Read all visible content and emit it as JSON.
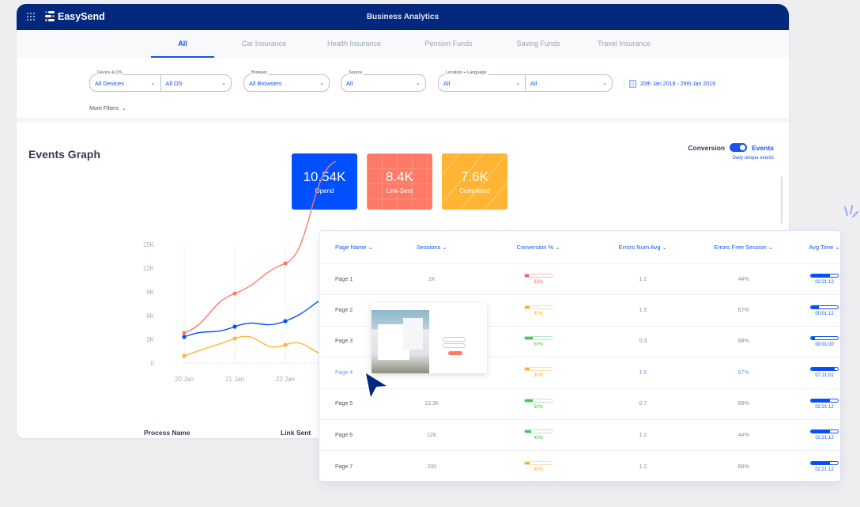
{
  "header": {
    "brand": "EasySend",
    "title": "Business Analytics"
  },
  "tabs": [
    {
      "label": "All",
      "active": true
    },
    {
      "label": "Car Insurance"
    },
    {
      "label": "Health Insurance"
    },
    {
      "label": "Pension Funds"
    },
    {
      "label": "Saving Funds"
    },
    {
      "label": "Travel Insurance"
    }
  ],
  "filters": {
    "device_os": {
      "label": "Device & OS",
      "device": "All Devices",
      "os": "All OS"
    },
    "browser": {
      "label": "Browser",
      "value": "All Browsers"
    },
    "source": {
      "label": "Source",
      "value": "All"
    },
    "location": {
      "label": "Location + Language",
      "location": "All",
      "language": "All"
    },
    "date_range": "20th Jan 2019 - 29th Jan 2019",
    "more_filters": "More Filters"
  },
  "graph": {
    "title": "Events Graph",
    "toggle": {
      "left": "Conversion",
      "right": "Events",
      "state": "Events",
      "caption": "Daily unique events"
    },
    "kpis": [
      {
        "value": "10.54K",
        "label": "Opend",
        "color": "#0050ff"
      },
      {
        "value": "8.4K",
        "label": "Link-Sent",
        "color": "#ff7a66"
      },
      {
        "value": "7.6K",
        "label": "Completed",
        "color": "#ffb433"
      }
    ],
    "bottom_headers": [
      "Process Name",
      "Link Sent"
    ]
  },
  "chart_data": {
    "type": "line",
    "x": [
      "20 Jan",
      "21 Jan",
      "22 Jan"
    ],
    "yticks": [
      "0",
      "3K",
      "6K",
      "9K",
      "12K",
      "15K"
    ],
    "ylim": [
      0,
      15000
    ],
    "grid": "vertical dashed",
    "series": [
      {
        "name": "Link-Sent",
        "color": "#ff7a66",
        "values": [
          3800,
          8800,
          12600
        ]
      },
      {
        "name": "Opend",
        "color": "#0050ff",
        "values": [
          3300,
          4600,
          5300
        ]
      },
      {
        "name": "Completed",
        "color": "#ffb433",
        "values": [
          900,
          3100,
          2300
        ]
      }
    ]
  },
  "table": {
    "columns": [
      "Page Name",
      "Sessions",
      "Conversion %",
      "Errors Num Avg",
      "Errors Free Session",
      "Avg Time"
    ],
    "rows": [
      {
        "page": "Page 1",
        "sessions": "1K",
        "conversion": "23%",
        "conv_value": 23,
        "conv_color": "#f25c54",
        "errors_avg": "1.2",
        "errors_free": "44%",
        "avg_time": "02:21:12",
        "time_fill": 70
      },
      {
        "page": "Page 2",
        "sessions": "",
        "conversion": "30%",
        "conv_value": 30,
        "conv_color": "#ffab2e",
        "errors_avg": "1.5",
        "errors_free": "67%",
        "avg_time": "00:01:12",
        "time_fill": 30
      },
      {
        "page": "Page 3",
        "sessions": "",
        "conversion": "50%",
        "conv_value": 50,
        "conv_color": "#46c45a",
        "errors_avg": "0.3",
        "errors_free": "88%",
        "avg_time": "00:01:00",
        "time_fill": 15
      },
      {
        "page": "Page 4",
        "sessions": "",
        "conversion": "30%",
        "conv_value": 30,
        "conv_color": "#ffab2e",
        "errors_avg": "1.5",
        "errors_free": "67%",
        "avg_time": "07:21:01",
        "time_fill": 88,
        "highlight": true
      },
      {
        "page": "Page 5",
        "sessions": "13.3K",
        "conversion": "50%",
        "conv_value": 50,
        "conv_color": "#46c45a",
        "errors_avg": "0.7",
        "errors_free": "88%",
        "avg_time": "02:21:12",
        "time_fill": 70
      },
      {
        "page": "Page 6",
        "sessions": "12K",
        "conversion": "40%",
        "conv_value": 40,
        "conv_color": "#46c45a",
        "errors_avg": "1.2",
        "errors_free": "44%",
        "avg_time": "02:21:12",
        "time_fill": 70
      },
      {
        "page": "Page 7",
        "sessions": "200",
        "conversion": "30%",
        "conv_value": 30,
        "conv_color": "#ffab2e",
        "errors_avg": "1.2",
        "errors_free": "88%",
        "avg_time": "02:21:12",
        "time_fill": 70
      }
    ]
  }
}
